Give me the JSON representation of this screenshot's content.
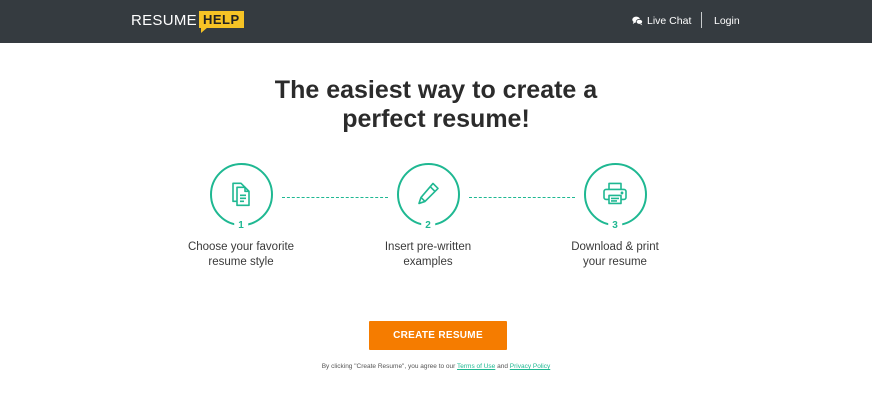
{
  "header": {
    "logo_text": "RESUME",
    "logo_badge": "HELP",
    "live_chat_label": "Live Chat",
    "login_label": "Login"
  },
  "hero": {
    "line1": "The easiest way to create a",
    "line2": "perfect resume!"
  },
  "steps": [
    {
      "number": "1",
      "line1": "Choose your favorite",
      "line2": "resume style",
      "icon": "documents-icon"
    },
    {
      "number": "2",
      "line1": "Insert pre-written",
      "line2": "examples",
      "icon": "pencil-icon"
    },
    {
      "number": "3",
      "line1": "Download & print",
      "line2": "your resume",
      "icon": "printer-icon"
    }
  ],
  "cta": {
    "label": "CREATE RESUME"
  },
  "legal": {
    "prefix": "By clicking \"Create Resume\", you agree to our",
    "terms_label": "Terms of Use",
    "and": "and",
    "privacy_label": "Privacy Policy"
  },
  "colors": {
    "topbar": "#353b40",
    "accent_green": "#1fb892",
    "cta_orange": "#f57c00",
    "logo_yellow": "#f6c325"
  }
}
